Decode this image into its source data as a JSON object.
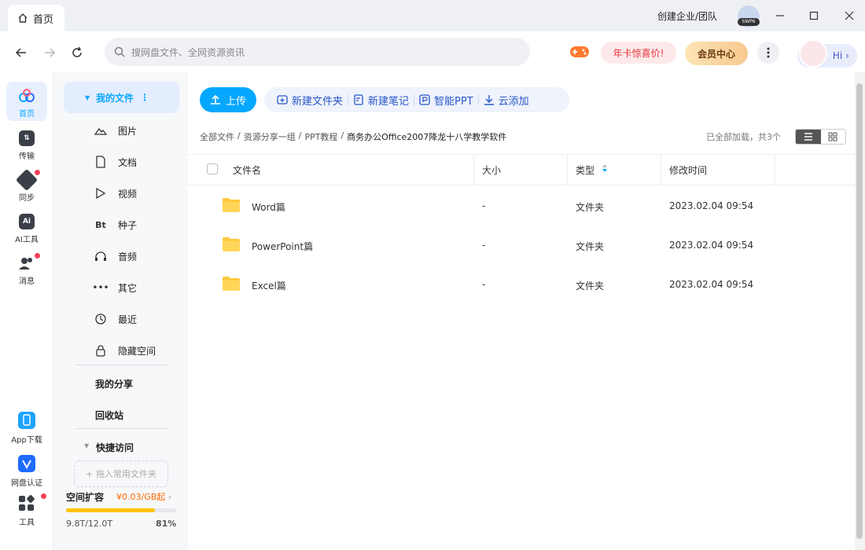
{
  "tab": {
    "label": "首页"
  },
  "titlebar": {
    "team_label": "创建企业/团队",
    "badge": "SWP6"
  },
  "search": {
    "placeholder": "搜网盘文件、全网资源资讯"
  },
  "promo": {
    "annual_label": "年卡惊喜价!",
    "vip_label": "会员中心",
    "hi_label": "Hi"
  },
  "rail": {
    "items": [
      {
        "label": "首页",
        "icon": "cloud-logo-icon"
      },
      {
        "label": "传输",
        "icon": "transfer-icon"
      },
      {
        "label": "同步",
        "icon": "sync-icon"
      },
      {
        "label": "AI工具",
        "icon": "ai-icon"
      },
      {
        "label": "消息",
        "icon": "message-icon"
      }
    ],
    "bottom": [
      {
        "label": "App下载",
        "icon": "phone-icon"
      },
      {
        "label": "网盘认证",
        "icon": "verify-icon"
      },
      {
        "label": "工具",
        "icon": "tools-icon"
      }
    ]
  },
  "sidebar": {
    "my_files": "我的文件",
    "items": [
      {
        "label": "图片",
        "icon": "image-icon"
      },
      {
        "label": "文档",
        "icon": "doc-icon"
      },
      {
        "label": "视频",
        "icon": "video-icon"
      },
      {
        "label": "种子",
        "icon": "bt-icon",
        "glyph": "Bt"
      },
      {
        "label": "音频",
        "icon": "headphone-icon"
      },
      {
        "label": "其它",
        "icon": "more-dots-icon"
      },
      {
        "label": "最近",
        "icon": "recent-icon"
      },
      {
        "label": "隐藏空间",
        "icon": "lock-icon"
      }
    ],
    "my_share": "我的分享",
    "recycle": "回收站",
    "quick_access": "快捷访问",
    "drop_hint": "+ 拖入常用文件夹",
    "quota": {
      "title": "空间扩容",
      "price": "¥0.03/GB起",
      "used": "9.8T/12.0T",
      "percent": "81%",
      "fill": 0.81
    }
  },
  "toolbar": {
    "upload": "上传",
    "new_folder": "新建文件夹",
    "new_note": "新建笔记",
    "smart_ppt": "智能PPT",
    "cloud_add": "云添加"
  },
  "breadcrumb": [
    "全部文件",
    "资源分享一组",
    "PPT教程",
    "商务办公Office2007降龙十八学教学软件"
  ],
  "status": {
    "loaded": "已全部加载，共3个"
  },
  "table": {
    "headers": {
      "name": "文件名",
      "size": "大小",
      "type": "类型",
      "modified": "修改时间"
    },
    "rows": [
      {
        "name": "Word篇",
        "size": "-",
        "type": "文件夹",
        "modified": "2023.02.04 09:54"
      },
      {
        "name": "PowerPoint篇",
        "size": "-",
        "type": "文件夹",
        "modified": "2023.02.04 09:54"
      },
      {
        "name": "Excel篇",
        "size": "-",
        "type": "文件夹",
        "modified": "2023.02.04 09:54"
      }
    ]
  },
  "colors": {
    "accent": "#06a7ff",
    "badge_red": "#f2405a",
    "folder": "#ffc93c"
  }
}
